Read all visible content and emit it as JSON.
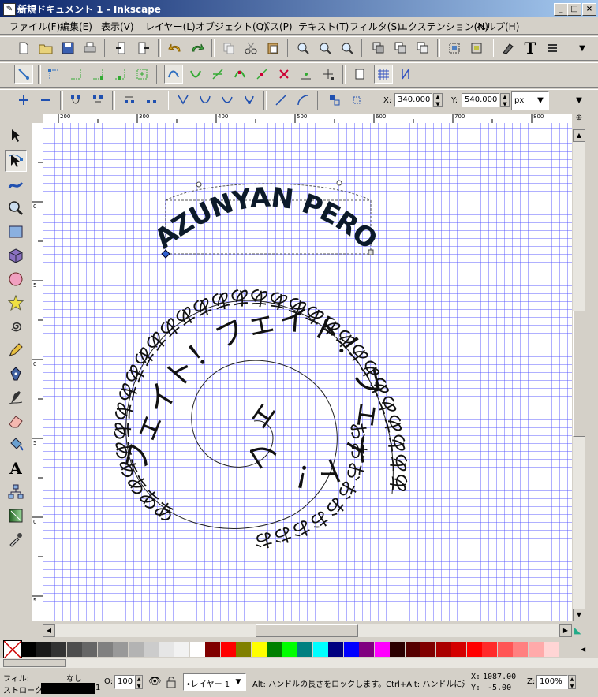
{
  "window": {
    "title": "新規ドキュメント 1 - Inkscape",
    "buttons": {
      "minimize": "_",
      "maximize": "□",
      "close": "×"
    }
  },
  "menu": {
    "items": [
      "ファイル(F)",
      "編集(E)",
      "表示(V)",
      "レイヤー(L)",
      "オブジェクト(O)",
      "パス(P)",
      "テキスト(T)",
      "フィルタ(S)",
      "エクステンション(N)",
      "ヘルプ(H)"
    ]
  },
  "node_toolbar": {
    "x_label": "X:",
    "x_value": "340.000",
    "y_label": "Y:",
    "y_value": "540.000",
    "unit": "px"
  },
  "ruler": {
    "h_labels": [
      "200",
      "300",
      "400",
      "500",
      "600",
      "700",
      "800"
    ],
    "v_labels": [
      "0",
      "5",
      "0",
      "5",
      "0",
      "5",
      "0",
      "5"
    ]
  },
  "canvas": {
    "arc_text": "AZUNYAN PEROPERO",
    "spiral_outer_text": "ああああああああああああああああああああああああああああああ",
    "spiral_inner_text": "フェイト！フェイト！フェイト！フェイト！",
    "spiral_small_text": "おおおおおおおおお"
  },
  "palette": {
    "colors": [
      "#000000",
      "#1a1a1a",
      "#333333",
      "#4d4d4d",
      "#666666",
      "#808080",
      "#999999",
      "#b3b3b3",
      "#cccccc",
      "#e6e6e6",
      "#f2f2f2",
      "#ffffff",
      "#800000",
      "#ff0000",
      "#808000",
      "#ffff00",
      "#008000",
      "#00ff00",
      "#008080",
      "#00ffff",
      "#000080",
      "#0000ff",
      "#800080",
      "#ff00ff",
      "#2b0000",
      "#550000",
      "#800000",
      "#aa0000",
      "#d40000",
      "#ff0000",
      "#ff2a2a",
      "#ff5555",
      "#ff8080",
      "#ffaaaa",
      "#ffd5d5"
    ]
  },
  "status": {
    "fill_label": "フィル:",
    "fill_value": "なし",
    "stroke_label": "ストローク:",
    "stroke_width": "1",
    "opacity_label": "O:",
    "opacity_value": "100",
    "layer_value": "•レイヤー 1",
    "message": "Alt: ハンドルの長さをロックします。Ctrl+Alt: ハンドルに沿...",
    "cursor_x_label": "X:",
    "cursor_x": "1087.00",
    "cursor_y_label": "Y:",
    "cursor_y": "-5.00",
    "zoom_label": "Z:",
    "zoom_value": "100%"
  }
}
